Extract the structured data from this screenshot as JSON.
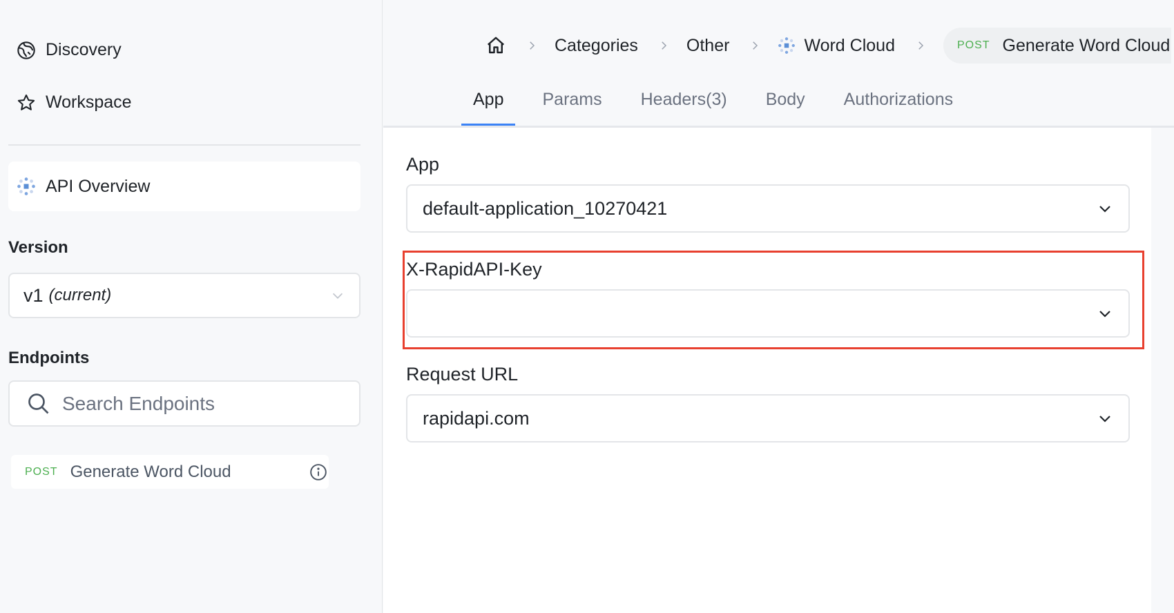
{
  "sidebar": {
    "nav": [
      {
        "label": "Discovery",
        "icon": "compass-icon"
      },
      {
        "label": "Workspace",
        "icon": "star-icon"
      }
    ],
    "overview_label": "API Overview",
    "version": {
      "label": "Version",
      "value": "v1",
      "current": "(current)"
    },
    "endpoints": {
      "label": "Endpoints",
      "search_placeholder": "Search Endpoints",
      "items": [
        {
          "method": "POST",
          "label": "Generate Word Cloud"
        }
      ]
    }
  },
  "breadcrumb": {
    "items": [
      "Categories",
      "Other",
      "Word Cloud"
    ],
    "current": {
      "method": "POST",
      "label": "Generate Word Cloud"
    }
  },
  "tabs": [
    {
      "label": "App",
      "active": true
    },
    {
      "label": "Params"
    },
    {
      "label": "Headers(3)"
    },
    {
      "label": "Body"
    },
    {
      "label": "Authorizations"
    }
  ],
  "form": {
    "app": {
      "label": "App",
      "value": "default-application_10270421"
    },
    "key": {
      "label": "X-RapidAPI-Key",
      "value": ""
    },
    "url": {
      "label": "Request URL",
      "value": "rapidapi.com"
    }
  },
  "colors": {
    "post": "#4caf50",
    "accent": "#3b82f6",
    "highlight": "#e8402f"
  }
}
